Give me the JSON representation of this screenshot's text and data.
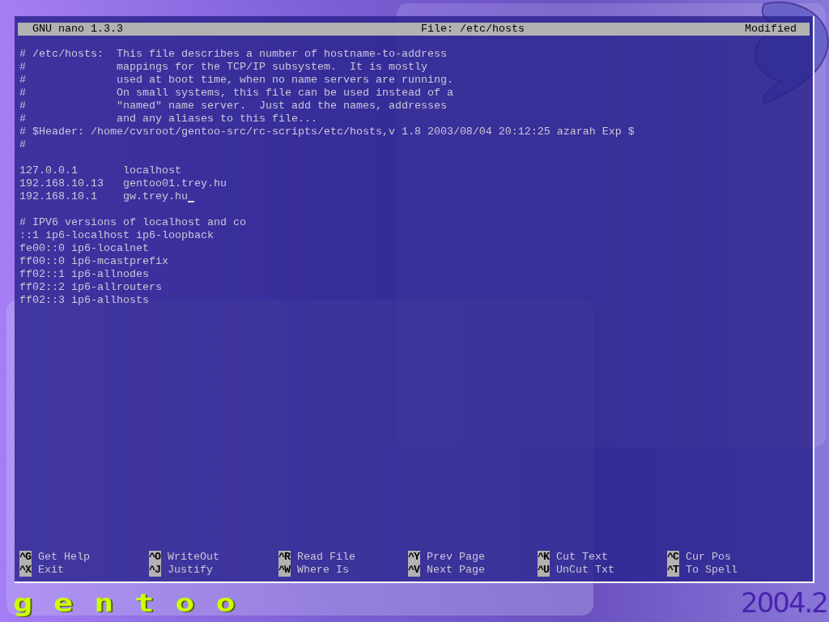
{
  "titlebar": {
    "app": "GNU nano 1.3.3",
    "file": "File: /etc/hosts",
    "status": "Modified"
  },
  "blocks": [
    {
      "lines": [
        {
          "text": "# /etc/hosts:  This file describes a number of hostname-to-address",
          "cursor": false
        },
        {
          "text": "#              mappings for the TCP/IP subsystem.  It is mostly",
          "cursor": false
        },
        {
          "text": "#              used at boot time, when no name servers are running.",
          "cursor": false
        },
        {
          "text": "#              On small systems, this file can be used instead of a",
          "cursor": false
        },
        {
          "text": "#              \"named\" name server.  Just add the names, addresses",
          "cursor": false
        },
        {
          "text": "#              and any aliases to this file...",
          "cursor": false
        },
        {
          "text": "# $Header: /home/cvsroot/gentoo-src/rc-scripts/etc/hosts,v 1.8 2003/08/04 20:12:25 azarah Exp $",
          "cursor": false
        },
        {
          "text": "#",
          "cursor": false
        }
      ]
    },
    {
      "lines": [
        {
          "text": "127.0.0.1       localhost",
          "cursor": false
        },
        {
          "text": "192.168.10.13   gentoo01.trey.hu",
          "cursor": false
        },
        {
          "text": "192.168.10.1    gw.trey.hu",
          "cursor": true
        }
      ]
    },
    {
      "lines": [
        {
          "text": "# IPV6 versions of localhost and co",
          "cursor": false
        },
        {
          "text": "::1 ip6-localhost ip6-loopback",
          "cursor": false
        },
        {
          "text": "fe00::0 ip6-localnet",
          "cursor": false
        },
        {
          "text": "ff00::0 ip6-mcastprefix",
          "cursor": false
        },
        {
          "text": "ff02::1 ip6-allnodes",
          "cursor": false
        },
        {
          "text": "ff02::2 ip6-allrouters",
          "cursor": false
        },
        {
          "text": "ff02::3 ip6-allhosts",
          "cursor": false
        }
      ]
    }
  ],
  "shortcuts": [
    [
      {
        "key": "^G",
        "label": "Get Help"
      },
      {
        "key": "^X",
        "label": "Exit"
      }
    ],
    [
      {
        "key": "^O",
        "label": "WriteOut"
      },
      {
        "key": "^J",
        "label": "Justify"
      }
    ],
    [
      {
        "key": "^R",
        "label": "Read File"
      },
      {
        "key": "^W",
        "label": "Where Is"
      }
    ],
    [
      {
        "key": "^Y",
        "label": "Prev Page"
      },
      {
        "key": "^V",
        "label": "Next Page"
      }
    ],
    [
      {
        "key": "^K",
        "label": "Cut Text"
      },
      {
        "key": "^U",
        "label": "UnCut Txt"
      }
    ],
    [
      {
        "key": "^C",
        "label": "Cur Pos"
      },
      {
        "key": "^T",
        "label": "To Spell"
      }
    ]
  ],
  "desktop": {
    "logo": "gentoo",
    "version": "2004.2"
  }
}
